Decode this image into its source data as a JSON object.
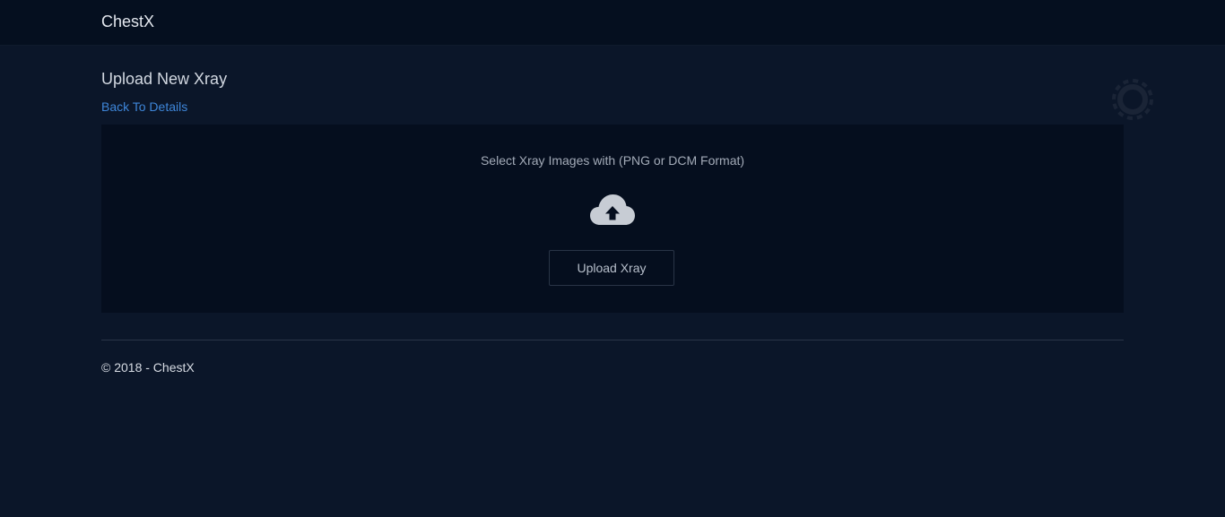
{
  "navbar": {
    "brand": "ChestX"
  },
  "main": {
    "title": "Upload New Xray",
    "back_link": "Back To Details",
    "upload": {
      "instructions": "Select Xray Images with (PNG or DCM Format)",
      "icon": "cloud-upload-icon",
      "button_label": "Upload Xray"
    }
  },
  "footer": {
    "text": "© 2018 - ChestX"
  },
  "colors": {
    "background": "#0b1629",
    "navbar": "#050f1f",
    "panel": "#050e1e",
    "link": "#3e86d9"
  }
}
